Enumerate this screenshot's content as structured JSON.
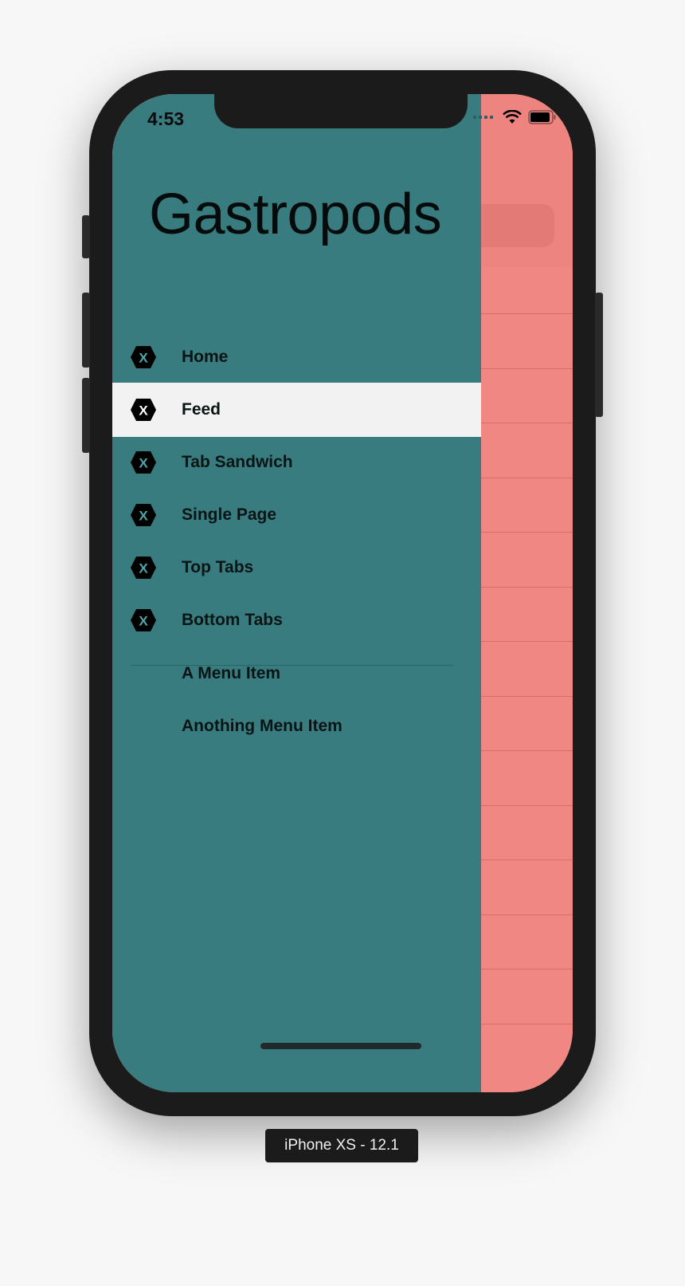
{
  "status_bar": {
    "time": "4:53",
    "wifi_icon": "wifi-icon",
    "battery_icon": "battery-icon"
  },
  "flyout": {
    "title": "Gastropods",
    "items": [
      {
        "label": "Home",
        "icon": "xamarin-hexagon-icon",
        "selected": false
      },
      {
        "label": "Feed",
        "icon": "xamarin-hexagon-icon",
        "selected": true
      },
      {
        "label": "Tab Sandwich",
        "icon": "xamarin-hexagon-icon",
        "selected": false
      },
      {
        "label": "Single Page",
        "icon": "xamarin-hexagon-icon",
        "selected": false
      },
      {
        "label": "Top Tabs",
        "icon": "xamarin-hexagon-icon",
        "selected": false
      },
      {
        "label": "Bottom Tabs",
        "icon": "xamarin-hexagon-icon",
        "selected": false
      }
    ],
    "menu_items": [
      {
        "label": "A Menu Item"
      },
      {
        "label": "Anothing Menu Item"
      }
    ],
    "colors": {
      "background": "#387c80",
      "selected": "#f2f2f2"
    }
  },
  "detail_page": {
    "background": "#f08783"
  },
  "device_label": "iPhone XS - 12.1"
}
